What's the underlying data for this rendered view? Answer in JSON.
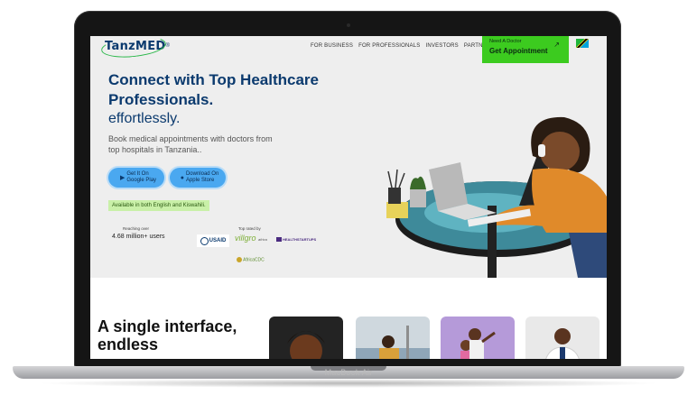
{
  "laptop": {
    "model_label": "MacBook Air"
  },
  "site": {
    "logo": {
      "part1": "TanzMED",
      "registered": "®"
    },
    "nav": [
      {
        "label": "FOR BUSINESS"
      },
      {
        "label": "FOR PROFESSIONALS"
      },
      {
        "label": "INVESTORS"
      },
      {
        "label": "PARTNERS"
      }
    ],
    "cta": {
      "small": "Need A Doctor",
      "main": "Get Appointment",
      "arrow": "↗"
    },
    "hero": {
      "title": "Connect with Top Healthcare Professionals.",
      "subtitle": "effortlessly.",
      "description": "Book medical appointments with doctors from top hospitals in Tanzania..",
      "google_play": {
        "line1": "Get It On",
        "line2": "Google Play"
      },
      "app_store": {
        "line1": "Download On",
        "line2": "Apple Store"
      },
      "language_badge": "Available in both English and Kiswahili.",
      "reach_label": "Reaching over",
      "reach_value": "4.68 million+ users",
      "rated_label": "Top rated by",
      "partners": {
        "usaid": "USAID",
        "villgro": "villgro",
        "villgro_sub": "africa",
        "hs": "HEALTHSTARTUPS",
        "africacdc": "AfricaCDC"
      }
    },
    "section": {
      "title": "A single interface, endless"
    }
  },
  "colors": {
    "brand_navy": "#0b3a6e",
    "cta_green": "#3ccb1f",
    "store_blue": "#4aa8f0",
    "badge_green": "#c9f0a8"
  }
}
